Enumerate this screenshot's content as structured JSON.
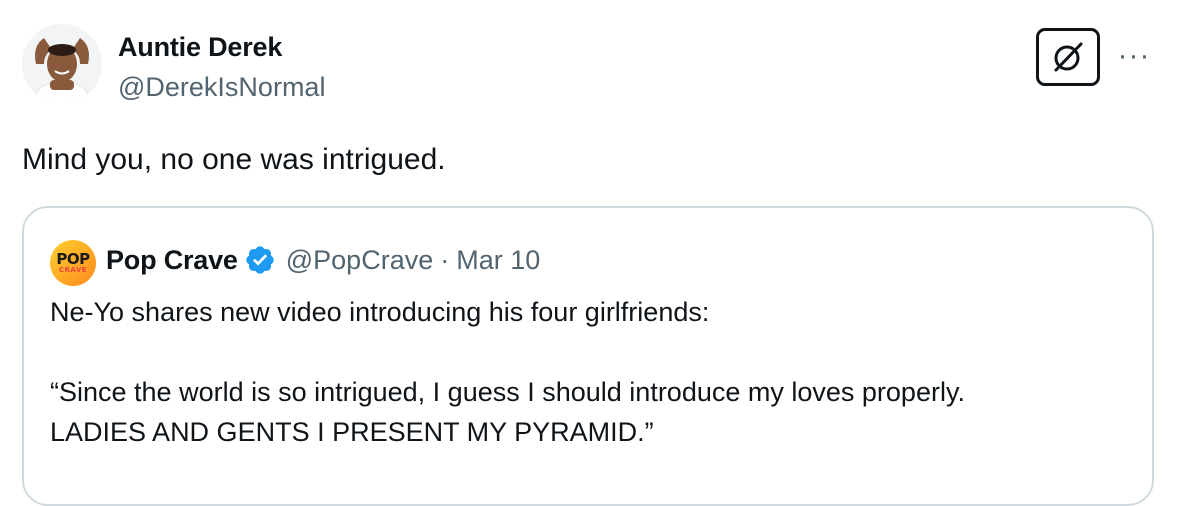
{
  "author": {
    "name": "Auntie Derek",
    "handle": "@DerekIsNormal"
  },
  "tweet": {
    "text": "Mind you, no one was intrigued."
  },
  "actions": {
    "grok_icon": "grok-slash-circle-icon",
    "more_icon": "more-dots-icon",
    "more_label": "···"
  },
  "quoted": {
    "logo": {
      "top": "POP",
      "bottom": "CRAVE"
    },
    "name": "Pop Crave",
    "verified_icon": "verified-badge-icon",
    "handle": "@PopCrave",
    "separator": "·",
    "date": "Mar 10",
    "line1": "Ne-Yo shares new video introducing his four girlfriends:",
    "line2": "“Since the world is so intrigued, I guess I should introduce my loves properly.",
    "line3": "LADIES AND GENTS I PRESENT MY PYRAMID.”"
  },
  "colors": {
    "text": "#0f1419",
    "secondary": "#536471",
    "border": "#cfd9de",
    "verified": "#1d9bf0"
  }
}
